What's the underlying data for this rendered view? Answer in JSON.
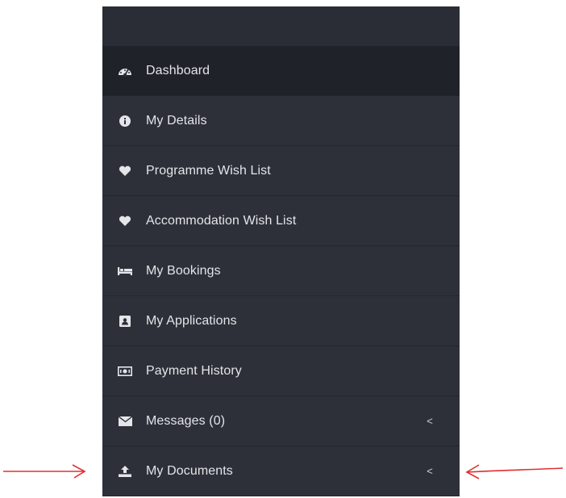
{
  "sidebar": {
    "items": [
      {
        "label": "Dashboard",
        "icon": "dashboard-icon",
        "active": true
      },
      {
        "label": "My Details",
        "icon": "info-icon"
      },
      {
        "label": "Programme Wish List",
        "icon": "heart-icon"
      },
      {
        "label": "Accommodation Wish List",
        "icon": "heart-icon"
      },
      {
        "label": "My Bookings",
        "icon": "bed-icon"
      },
      {
        "label": "My Applications",
        "icon": "contact-card-icon"
      },
      {
        "label": "Payment History",
        "icon": "money-icon"
      },
      {
        "label": "Messages (0)",
        "icon": "envelope-icon",
        "chevron": "<"
      },
      {
        "label": "My Documents",
        "icon": "upload-icon",
        "chevron": "<"
      }
    ]
  },
  "annotations": {
    "arrow_color": "#e03030"
  },
  "colors": {
    "sidebar_bg": "#2d3039",
    "active_bg": "#1f2228",
    "text": "#e3e5e8"
  }
}
